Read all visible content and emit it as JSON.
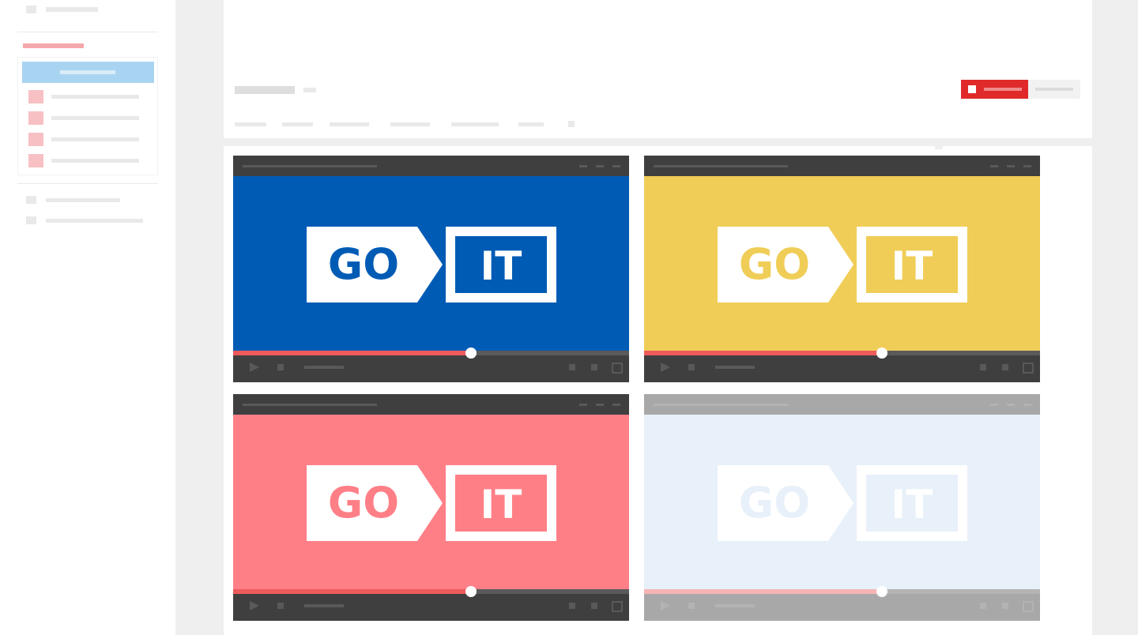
{
  "sidebar": {
    "top_items": [
      "menu-item"
    ],
    "section_heading": "section",
    "active_group": {
      "primary_button": "primary",
      "items": [
        "item-1",
        "item-2",
        "item-3",
        "item-4"
      ]
    },
    "bottom_items": [
      "item-5",
      "item-6"
    ],
    "colors": {
      "accent_pink": "#f5a8ab",
      "accent_blue": "#a9d4f1"
    }
  },
  "header": {
    "subscribe_button_color": "#e02a2a",
    "tab_count": 7
  },
  "videos": [
    {
      "id": "v1",
      "brand_left": "GO",
      "brand_right": "IT",
      "bg": "#005bb5",
      "accent": "#005bb5",
      "progress": 0.6,
      "disabled": false
    },
    {
      "id": "v2",
      "brand_left": "GO",
      "brand_right": "IT",
      "bg": "#f0cd57",
      "accent": "#f0cd57",
      "progress": 0.6,
      "disabled": false
    },
    {
      "id": "v3",
      "brand_left": "GO",
      "brand_right": "IT",
      "bg": "#ff7f87",
      "accent": "#ff7f87",
      "progress": 0.6,
      "disabled": false
    },
    {
      "id": "v4",
      "brand_left": "GO",
      "brand_right": "IT",
      "bg": "#cddff2",
      "accent": "#cddff2",
      "progress": 0.6,
      "disabled": true
    }
  ],
  "colors": {
    "frame": "#3f3f3f",
    "progress": "#ee5b5b",
    "page_bg": "#efefef"
  }
}
